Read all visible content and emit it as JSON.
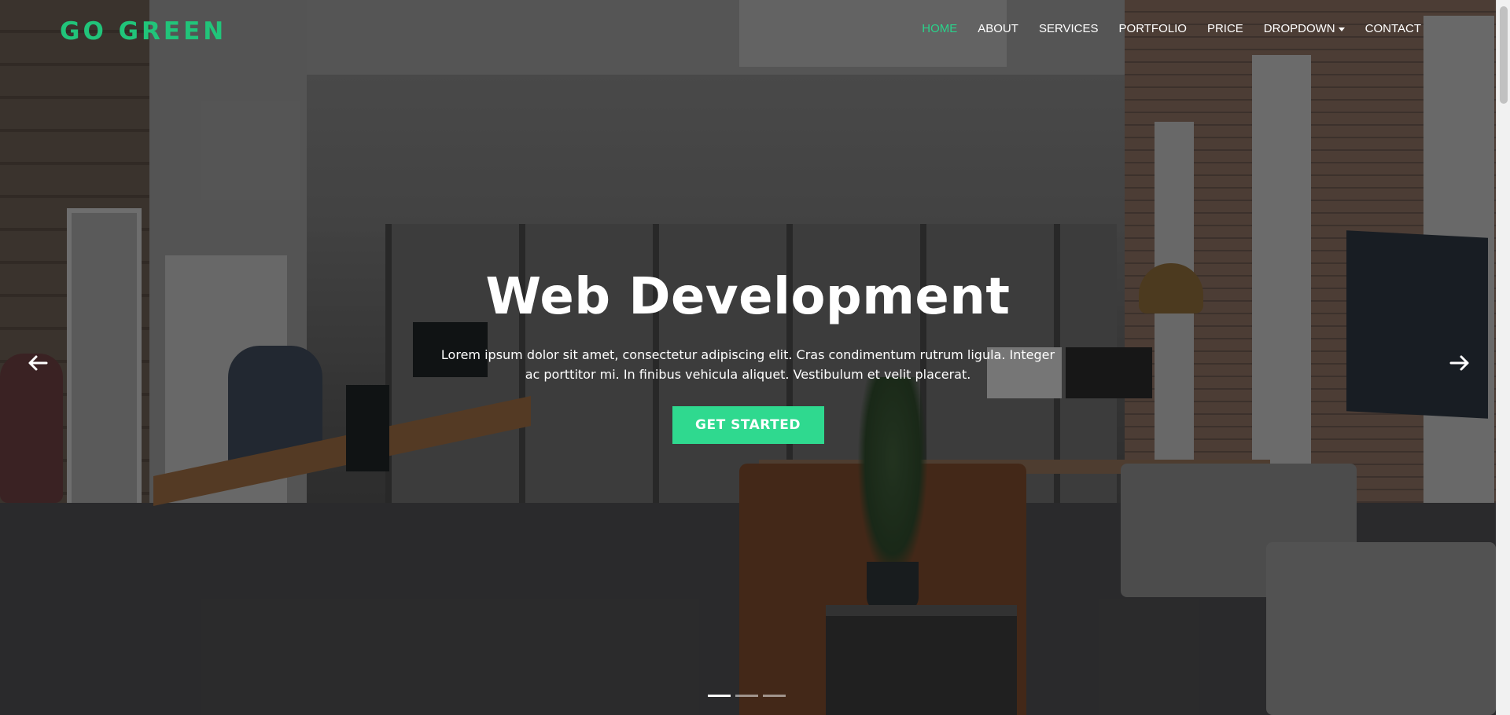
{
  "brand": {
    "name": "GO GREEN",
    "color": "#21c47a"
  },
  "nav": {
    "items": [
      {
        "label": "HOME",
        "active": true
      },
      {
        "label": "ABOUT"
      },
      {
        "label": "SERVICES"
      },
      {
        "label": "PORTFOLIO"
      },
      {
        "label": "PRICE"
      },
      {
        "label": "DROPDOWN",
        "has_caret": true
      },
      {
        "label": "CONTACT"
      }
    ],
    "active_color": "#2ad38b"
  },
  "hero": {
    "title": "Web Development",
    "text": "Lorem ipsum dolor sit amet, consectetur adipiscing elit. Cras condimentum rutrum ligula. Integer ac porttitor mi. In finibus vehicula aliquet. Vestibulum et velit placerat.",
    "cta_label": "GET STARTED",
    "cta_color": "#2fd98f"
  },
  "carousel": {
    "prev_icon": "arrow-left-icon",
    "next_icon": "arrow-right-icon",
    "slide_count": 3,
    "active_index": 0
  }
}
